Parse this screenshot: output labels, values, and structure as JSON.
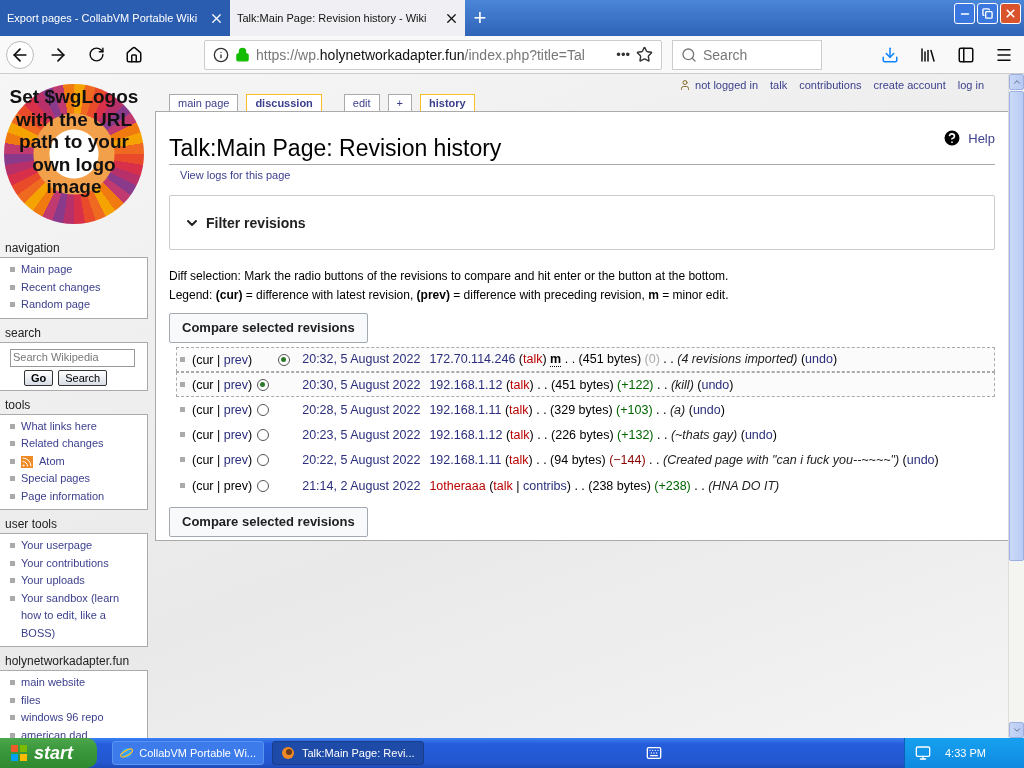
{
  "browser": {
    "tabs": [
      {
        "title": "Export pages - CollabVM Portable Wiki",
        "selected": false
      },
      {
        "title": "Talk:Main Page: Revision history - Wiki",
        "selected": true
      }
    ],
    "new_tab": "+",
    "url": {
      "prefix": "https://wp.",
      "domain": "holynetworkadapter.fun",
      "path": "/index.php?title=Tal"
    },
    "page_actions": "•••",
    "search": {
      "placeholder": "Search"
    }
  },
  "sidebar": {
    "logo_text": "Set $wgLogos with the URL path to your own logo image",
    "portlets": [
      {
        "title": "navigation",
        "items": [
          {
            "label": "Main page",
            "kind": "link"
          },
          {
            "label": "Recent changes",
            "kind": "link"
          },
          {
            "label": "Random page",
            "kind": "link"
          }
        ]
      },
      {
        "title": "search",
        "kind": "search",
        "placeholder": "Search Wikipedia",
        "buttons": [
          "Go",
          "Search"
        ]
      },
      {
        "title": "tools",
        "items": [
          {
            "label": "What links here",
            "kind": "link"
          },
          {
            "label": "Related changes",
            "kind": "link"
          },
          {
            "label": "Atom",
            "kind": "feed"
          },
          {
            "label": "Special pages",
            "kind": "link"
          },
          {
            "label": "Page information",
            "kind": "link"
          }
        ]
      },
      {
        "title": "user tools",
        "items": [
          {
            "label": "Your userpage",
            "kind": "link"
          },
          {
            "label": "Your contributions",
            "kind": "link"
          },
          {
            "label": "Your uploads",
            "kind": "link"
          },
          {
            "label": "Your sandbox (learn how to edit, like a BOSS)",
            "kind": "link"
          }
        ]
      },
      {
        "title": "holynetworkadapter.fun",
        "items": [
          {
            "label": "main website",
            "kind": "link"
          },
          {
            "label": "files",
            "kind": "link"
          },
          {
            "label": "windows 96 repo",
            "kind": "link"
          },
          {
            "label": "american dad",
            "kind": "link"
          }
        ]
      }
    ]
  },
  "personal": [
    "not logged in",
    "talk",
    "contributions",
    "create account",
    "log in"
  ],
  "page_tabs": [
    {
      "label": "main page",
      "selected": false
    },
    {
      "label": "discussion",
      "selected": true
    },
    {
      "label": "edit",
      "selected": false
    },
    {
      "label": "+",
      "selected": false
    },
    {
      "label": "history",
      "selected": true
    }
  ],
  "content": {
    "title": "Talk:Main Page: Revision history",
    "help": "Help",
    "subtitle": "View logs for this page",
    "filter": {
      "label": "Filter revisions",
      "expanded": false
    },
    "intro": [
      "Diff selection: Mark the radio buttons of the revisions to compare and hit enter or the button at the bottom.",
      "Legend: **(cur)** = difference with latest revision, **(prev)** = difference with preceding revision, **m** = minor edit."
    ],
    "compare_button_top": "Compare selected revisions",
    "compare_button_bottom": "Compare selected revisions",
    "revisions": [
      {
        "in_range": true,
        "lead": [
          {
            "text": "(cur | ",
            "kind": "plain"
          },
          {
            "text": "prev",
            "kind": "link"
          },
          {
            "text": ")",
            "kind": "plain"
          }
        ],
        "radio_right": {
          "selected": true
        },
        "parts": [
          {
            "text": "20:32, 5 August 2022",
            "kind": "link"
          },
          {
            "text": "172.70.114.246",
            "kind": "link"
          },
          {
            "text": " (",
            "kind": "plain"
          },
          {
            "text": "talk",
            "kind": "newlink"
          },
          {
            "text": ") ",
            "kind": "plain"
          },
          {
            "text": "m",
            "kind": "minor"
          },
          {
            "text": " . . (451 bytes) ",
            "kind": "plain"
          },
          {
            "text": "(0)",
            "kind": "zero"
          },
          {
            "text": " . . ",
            "kind": "plain"
          },
          {
            "text": "(4 revisions imported)",
            "kind": "comment"
          },
          {
            "text": " (",
            "kind": "plain"
          },
          {
            "text": "undo",
            "kind": "link"
          },
          {
            "text": ")",
            "kind": "plain"
          }
        ]
      },
      {
        "in_range": true,
        "lead": [
          {
            "text": "(cur | ",
            "kind": "plain"
          },
          {
            "text": "prev",
            "kind": "link"
          },
          {
            "text": ")",
            "kind": "plain"
          }
        ],
        "radio_left": {
          "selected": true
        },
        "parts": [
          {
            "text": "20:30, 5 August 2022",
            "kind": "link"
          },
          {
            "text": "192.168.1.12",
            "kind": "link"
          },
          {
            "text": " (",
            "kind": "plain"
          },
          {
            "text": "talk",
            "kind": "newlink"
          },
          {
            "text": ") . . (451 bytes) ",
            "kind": "plain"
          },
          {
            "text": "(+122)",
            "kind": "plus"
          },
          {
            "text": " . . ",
            "kind": "plain"
          },
          {
            "text": "(kill)",
            "kind": "comment"
          },
          {
            "text": " (",
            "kind": "plain"
          },
          {
            "text": "undo",
            "kind": "link"
          },
          {
            "text": ")",
            "kind": "plain"
          }
        ]
      },
      {
        "in_range": false,
        "lead": [
          {
            "text": "(cur | ",
            "kind": "plain"
          },
          {
            "text": "prev",
            "kind": "link"
          },
          {
            "text": ")",
            "kind": "plain"
          }
        ],
        "radio_left": {
          "selected": false
        },
        "parts": [
          {
            "text": "20:28, 5 August 2022",
            "kind": "link"
          },
          {
            "text": "192.168.1.11",
            "kind": "link"
          },
          {
            "text": " (",
            "kind": "plain"
          },
          {
            "text": "talk",
            "kind": "newlink"
          },
          {
            "text": ") . . (329 bytes) ",
            "kind": "plain"
          },
          {
            "text": "(+103)",
            "kind": "plus"
          },
          {
            "text": " . . ",
            "kind": "plain"
          },
          {
            "text": "(a)",
            "kind": "comment"
          },
          {
            "text": " (",
            "kind": "plain"
          },
          {
            "text": "undo",
            "kind": "link"
          },
          {
            "text": ")",
            "kind": "plain"
          }
        ]
      },
      {
        "in_range": false,
        "lead": [
          {
            "text": "(cur | ",
            "kind": "plain"
          },
          {
            "text": "prev",
            "kind": "link"
          },
          {
            "text": ")",
            "kind": "plain"
          }
        ],
        "radio_left": {
          "selected": false
        },
        "parts": [
          {
            "text": "20:23, 5 August 2022",
            "kind": "link"
          },
          {
            "text": "192.168.1.12",
            "kind": "link"
          },
          {
            "text": " (",
            "kind": "plain"
          },
          {
            "text": "talk",
            "kind": "newlink"
          },
          {
            "text": ") . . (226 bytes) ",
            "kind": "plain"
          },
          {
            "text": "(+132)",
            "kind": "plus"
          },
          {
            "text": " . . ",
            "kind": "plain"
          },
          {
            "text": "(~thats gay)",
            "kind": "comment"
          },
          {
            "text": " (",
            "kind": "plain"
          },
          {
            "text": "undo",
            "kind": "link"
          },
          {
            "text": ")",
            "kind": "plain"
          }
        ]
      },
      {
        "in_range": false,
        "lead": [
          {
            "text": "(cur | ",
            "kind": "plain"
          },
          {
            "text": "prev",
            "kind": "link"
          },
          {
            "text": ")",
            "kind": "plain"
          }
        ],
        "radio_left": {
          "selected": false
        },
        "parts": [
          {
            "text": "20:22, 5 August 2022",
            "kind": "link"
          },
          {
            "text": "192.168.1.11",
            "kind": "link"
          },
          {
            "text": " (",
            "kind": "plain"
          },
          {
            "text": "talk",
            "kind": "newlink"
          },
          {
            "text": ") . . (94 bytes) ",
            "kind": "plain"
          },
          {
            "text": "(−144)",
            "kind": "minus"
          },
          {
            "text": " . . ",
            "kind": "plain"
          },
          {
            "text": "(Created page with \"can i fuck you--~~~~\")",
            "kind": "comment"
          },
          {
            "text": " (",
            "kind": "plain"
          },
          {
            "text": "undo",
            "kind": "link"
          },
          {
            "text": ")",
            "kind": "plain"
          }
        ]
      },
      {
        "in_range": false,
        "lead": [
          {
            "text": "(cur | prev)",
            "kind": "plain"
          }
        ],
        "radio_left": {
          "selected": false
        },
        "parts": [
          {
            "text": "21:14, 2 August 2022",
            "kind": "link"
          },
          {
            "text": "1otheraaa",
            "kind": "newlink"
          },
          {
            "text": " (",
            "kind": "plain"
          },
          {
            "text": "talk",
            "kind": "newlink"
          },
          {
            "text": " | ",
            "kind": "plain"
          },
          {
            "text": "contribs",
            "kind": "link"
          },
          {
            "text": ") . . (238 bytes) ",
            "kind": "plain"
          },
          {
            "text": "(+238)",
            "kind": "plus"
          },
          {
            "text": " . . ",
            "kind": "plain"
          },
          {
            "text": "(HNA DO IT)",
            "kind": "comment"
          }
        ]
      }
    ]
  },
  "taskbar": {
    "start": "start",
    "tasks": [
      {
        "title": "CollabVM Portable Wi...",
        "kind": "ie",
        "selected": false
      },
      {
        "title": "Talk:Main Page: Revi...",
        "kind": "firefox",
        "selected": true
      }
    ],
    "clock": "4:33 PM"
  }
}
